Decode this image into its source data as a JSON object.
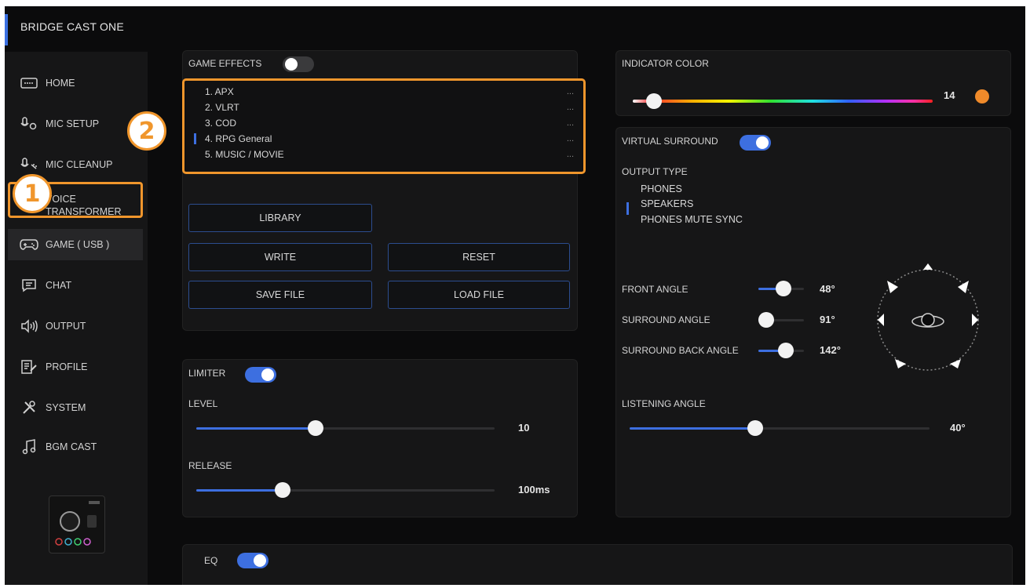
{
  "app": {
    "title": "BRIDGE CAST ONE"
  },
  "sidebar": {
    "items": [
      {
        "label": "HOME",
        "icon": "keyboard-icon"
      },
      {
        "label": "MIC SETUP",
        "icon": "mic-settings-icon"
      },
      {
        "label": "MIC CLEANUP",
        "icon": "mic-sparkle-icon"
      },
      {
        "label": "VOICE\nTRANSFORMER",
        "icon": "voice-wave-icon"
      },
      {
        "label": "GAME ( USB )",
        "icon": "gamepad-icon"
      },
      {
        "label": "CHAT",
        "icon": "chat-bubble-icon"
      },
      {
        "label": "OUTPUT",
        "icon": "speaker-icon"
      },
      {
        "label": "PROFILE",
        "icon": "profile-doc-icon"
      },
      {
        "label": "SYSTEM",
        "icon": "tools-icon"
      },
      {
        "label": "BGM CAST",
        "icon": "music-note-icon"
      }
    ],
    "active": "GAME ( USB )"
  },
  "annotations": {
    "badge1": "1",
    "badge2": "2",
    "highlight_color": "#f0962c"
  },
  "game_effects": {
    "label": "GAME EFFECTS",
    "enabled": false,
    "presets": [
      {
        "label": "1. APX",
        "more": "..."
      },
      {
        "label": "2. VLRT",
        "more": "..."
      },
      {
        "label": "3. COD",
        "more": "..."
      },
      {
        "label": "4. RPG General",
        "more": "..."
      },
      {
        "label": "5. MUSIC / MOVIE",
        "more": "..."
      }
    ],
    "selected_index": 3,
    "buttons": {
      "library": "LIBRARY",
      "write": "WRITE",
      "reset": "RESET",
      "save": "SAVE FILE",
      "load": "LOAD FILE"
    }
  },
  "limiter": {
    "label": "LIMITER",
    "enabled": true,
    "level": {
      "label": "LEVEL",
      "value": "10",
      "fraction": 0.4
    },
    "release": {
      "label": "RELEASE",
      "value": "100ms",
      "fraction": 0.29
    }
  },
  "eq": {
    "label": "EQ",
    "enabled": true
  },
  "indicator": {
    "label": "INDICATOR COLOR",
    "value": "14",
    "fraction": 0.07,
    "swatch": "#f08a2a"
  },
  "surround": {
    "label": "VIRTUAL SURROUND",
    "enabled": true,
    "output_type_label": "OUTPUT TYPE",
    "output_options": [
      "PHONES",
      "SPEAKERS",
      "PHONES MUTE SYNC"
    ],
    "selected_output": "SPEAKERS",
    "front": {
      "label": "FRONT ANGLE",
      "value": "48°",
      "fraction": 0.55
    },
    "surround": {
      "label": "SURROUND ANGLE",
      "value": "91°",
      "fraction": 0.0
    },
    "back": {
      "label": "SURROUND BACK ANGLE",
      "value": "142°",
      "fraction": 0.6
    },
    "listening": {
      "label": "LISTENING ANGLE",
      "value": "40°",
      "fraction": 0.42
    }
  },
  "colors": {
    "accent": "#3d6fe0",
    "background": "#0b0b0c",
    "panel": "#161617"
  }
}
